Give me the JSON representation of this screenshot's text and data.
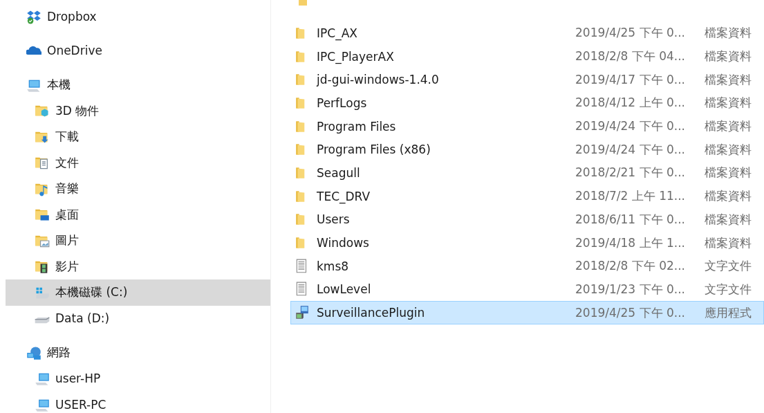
{
  "sidebar": {
    "items": [
      {
        "label": "Dropbox",
        "kind": "group",
        "selected": false
      },
      {
        "label": "OneDrive",
        "kind": "group",
        "selected": false
      },
      {
        "label": "本機",
        "kind": "group",
        "selected": false
      },
      {
        "label": "3D 物件",
        "kind": "child",
        "selected": false
      },
      {
        "label": "下載",
        "kind": "child",
        "selected": false
      },
      {
        "label": "文件",
        "kind": "child",
        "selected": false
      },
      {
        "label": "音樂",
        "kind": "child",
        "selected": false
      },
      {
        "label": "桌面",
        "kind": "child",
        "selected": false
      },
      {
        "label": "圖片",
        "kind": "child",
        "selected": false
      },
      {
        "label": "影片",
        "kind": "child",
        "selected": false
      },
      {
        "label": "本機磁碟 (C:)",
        "kind": "child",
        "selected": true
      },
      {
        "label": "Data (D:)",
        "kind": "child",
        "selected": false
      },
      {
        "label": "網路",
        "kind": "group",
        "selected": false
      },
      {
        "label": "user-HP",
        "kind": "child",
        "selected": false
      },
      {
        "label": "USER-PC",
        "kind": "child",
        "selected": false
      }
    ]
  },
  "files": {
    "rows": [
      {
        "name": "IPC_AX",
        "modified": "2019/4/25 下午 0...",
        "type": "檔案資料",
        "kind": "folder",
        "selected": false
      },
      {
        "name": "IPC_PlayerAX",
        "modified": "2018/2/8 下午 04...",
        "type": "檔案資料",
        "kind": "folder",
        "selected": false
      },
      {
        "name": "jd-gui-windows-1.4.0",
        "modified": "2019/4/17 下午 0...",
        "type": "檔案資料",
        "kind": "folder",
        "selected": false
      },
      {
        "name": "PerfLogs",
        "modified": "2018/4/12 上午 0...",
        "type": "檔案資料",
        "kind": "folder",
        "selected": false
      },
      {
        "name": "Program Files",
        "modified": "2019/4/24 下午 0...",
        "type": "檔案資料",
        "kind": "folder",
        "selected": false
      },
      {
        "name": "Program Files (x86)",
        "modified": "2019/4/24 下午 0...",
        "type": "檔案資料",
        "kind": "folder",
        "selected": false
      },
      {
        "name": "Seagull",
        "modified": "2018/2/21 下午 0...",
        "type": "檔案資料",
        "kind": "folder",
        "selected": false
      },
      {
        "name": "TEC_DRV",
        "modified": "2018/7/2 上午 11...",
        "type": "檔案資料",
        "kind": "folder",
        "selected": false
      },
      {
        "name": "Users",
        "modified": "2018/6/11 下午 0...",
        "type": "檔案資料",
        "kind": "folder",
        "selected": false
      },
      {
        "name": "Windows",
        "modified": "2019/4/18 上午 1...",
        "type": "檔案資料",
        "kind": "folder",
        "selected": false
      },
      {
        "name": "kms8",
        "modified": "2018/2/8 下午 02...",
        "type": "文字文件",
        "kind": "text",
        "selected": false
      },
      {
        "name": "LowLevel",
        "modified": "2019/1/23 下午 0...",
        "type": "文字文件",
        "kind": "text",
        "selected": false
      },
      {
        "name": "SurveillancePlugin",
        "modified": "2019/4/25 下午 0...",
        "type": "應用程式",
        "kind": "installer",
        "selected": true
      }
    ]
  }
}
